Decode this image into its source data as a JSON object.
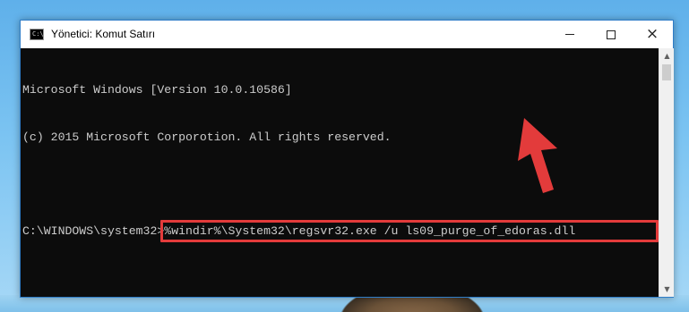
{
  "window": {
    "title": "Yönetici: Komut Satırı",
    "icon": "cmd-icon",
    "controls": {
      "minimize": "minimize-icon",
      "maximize": "maximize-icon",
      "close": "×"
    }
  },
  "console": {
    "lines": [
      "Microsoft Windows [Version 10.0.10586]",
      "(c) 2015 Microsoft Corporotion. All rights reserved.",
      ""
    ],
    "prompt": "C:\\WINDOWS\\system32>",
    "command": "%windir%\\System32\\regsvr32.exe /u ls09_purge_of_edoras.dll"
  },
  "scrollbar": {
    "up": "▲",
    "down": "▼"
  },
  "annotation": {
    "highlight_color": "#e33b3b",
    "arrow": "red-arrow-icon"
  }
}
